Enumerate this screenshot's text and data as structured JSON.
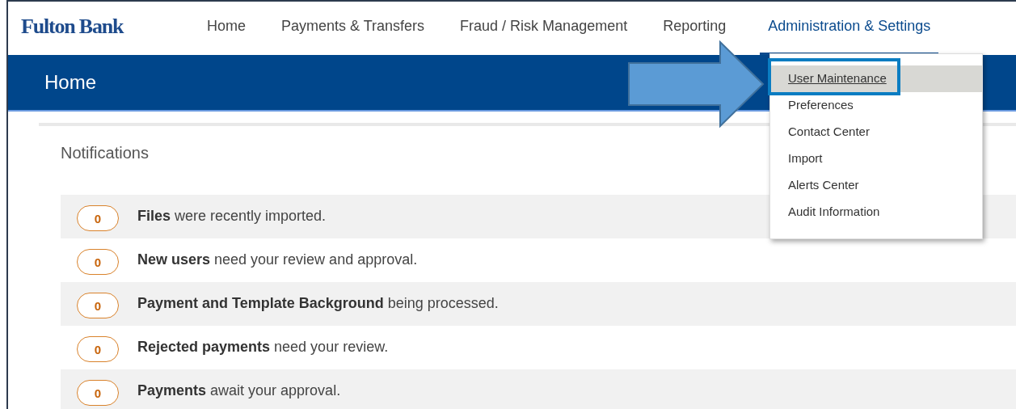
{
  "logo": "Fulton Bank",
  "nav": [
    {
      "label": "Home",
      "selected": false
    },
    {
      "label": "Payments & Transfers",
      "selected": false
    },
    {
      "label": "Fraud / Risk Management",
      "selected": false
    },
    {
      "label": "Reporting",
      "selected": false
    },
    {
      "label": "Administration & Settings",
      "selected": true
    }
  ],
  "page_title": "Home",
  "dropdown": [
    {
      "label": "User Maintenance",
      "selected": true
    },
    {
      "label": "Preferences",
      "selected": false
    },
    {
      "label": "Contact Center",
      "selected": false
    },
    {
      "label": "Import",
      "selected": false
    },
    {
      "label": "Alerts Center",
      "selected": false
    },
    {
      "label": "Audit Information",
      "selected": false
    }
  ],
  "notifications": {
    "title": "Notifications",
    "items": [
      {
        "count": "0",
        "text": "**Files** were recently imported."
      },
      {
        "count": "0",
        "text": "**New users** need your review and approval."
      },
      {
        "count": "0",
        "text": "**Payment and Template Background** being processed."
      },
      {
        "count": "0",
        "text": "**Rejected payments** need your review."
      },
      {
        "count": "0",
        "text": "**Payments** await your approval."
      }
    ]
  }
}
